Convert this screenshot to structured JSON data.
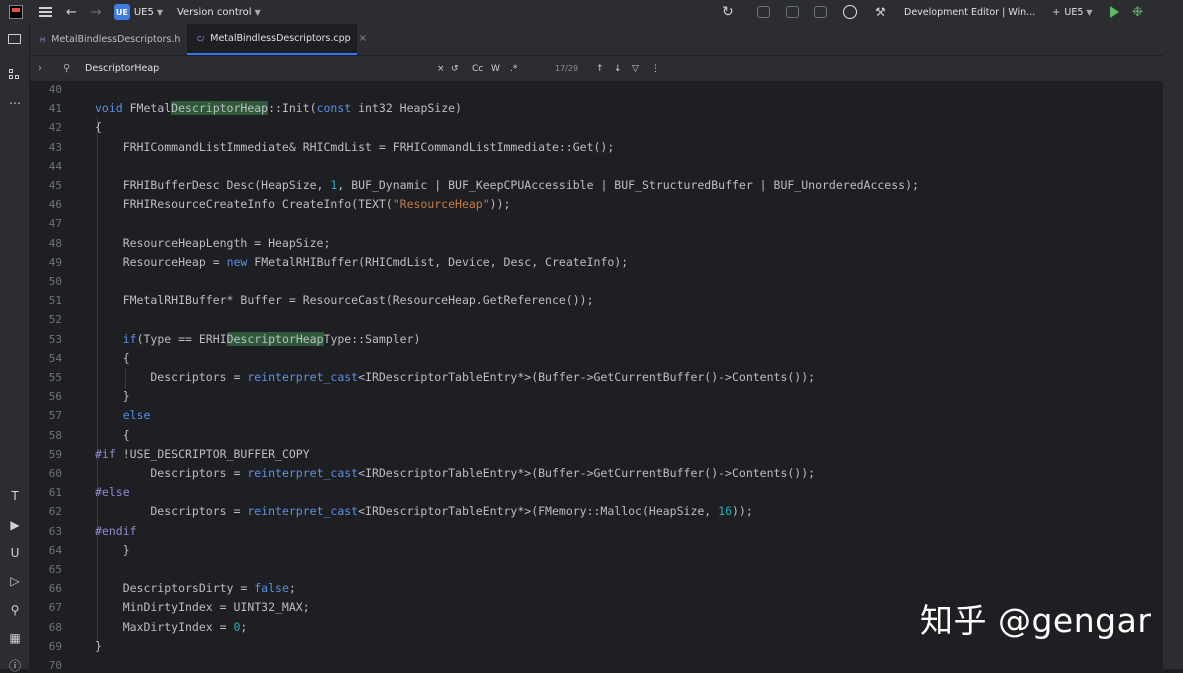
{
  "titlebar": {
    "project_badge": "UE",
    "project_name": "UE5",
    "version_control": "Version control",
    "run_config": "Development Editor | Win...",
    "target": "UE5"
  },
  "tabs": [
    {
      "type": "H",
      "label": "MetalBindlessDescriptors.h",
      "active": false
    },
    {
      "type": "C/",
      "label": "MetalBindlessDescriptors.cpp",
      "active": true
    }
  ],
  "find": {
    "query": "DescriptorHeap",
    "options": [
      "Cc",
      "W",
      ".*"
    ],
    "count": "17/29"
  },
  "colors": {
    "keyword": "#5c8fe3",
    "string": "#c77c47",
    "number": "#2aacb8",
    "preprocessor": "#908bd6",
    "match_highlight": "#2e5a3a"
  },
  "code_lines": [
    {
      "num": "40",
      "text": ""
    },
    {
      "num": "41",
      "text": "void FMetalDescriptorHeap::Init(const int32 HeapSize)"
    },
    {
      "num": "42",
      "text": "{"
    },
    {
      "num": "43",
      "text": "    FRHICommandListImmediate& RHICmdList = FRHICommandListImmediate::Get();"
    },
    {
      "num": "44",
      "text": ""
    },
    {
      "num": "45",
      "text": "    FRHIBufferDesc Desc(HeapSize, 1, BUF_Dynamic | BUF_KeepCPUAccessible | BUF_StructuredBuffer | BUF_UnorderedAccess);"
    },
    {
      "num": "46",
      "text": "    FRHIResourceCreateInfo CreateInfo(TEXT(\"ResourceHeap\"));"
    },
    {
      "num": "47",
      "text": ""
    },
    {
      "num": "48",
      "text": "    ResourceHeapLength = HeapSize;"
    },
    {
      "num": "49",
      "text": "    ResourceHeap = new FMetalRHIBuffer(RHICmdList, Device, Desc, CreateInfo);"
    },
    {
      "num": "50",
      "text": ""
    },
    {
      "num": "51",
      "text": "    FMetalRHIBuffer* Buffer = ResourceCast(ResourceHeap.GetReference());"
    },
    {
      "num": "52",
      "text": ""
    },
    {
      "num": "53",
      "text": "    if(Type == ERHIDescriptorHeapType::Sampler)"
    },
    {
      "num": "54",
      "text": "    {"
    },
    {
      "num": "55",
      "text": "        Descriptors = reinterpret_cast<IRDescriptorTableEntry*>(Buffer->GetCurrentBuffer()->Contents());"
    },
    {
      "num": "56",
      "text": "    }"
    },
    {
      "num": "57",
      "text": "    else"
    },
    {
      "num": "58",
      "text": "    {"
    },
    {
      "num": "59",
      "text": "#if !USE_DESCRIPTOR_BUFFER_COPY"
    },
    {
      "num": "60",
      "text": "        Descriptors = reinterpret_cast<IRDescriptorTableEntry*>(Buffer->GetCurrentBuffer()->Contents());"
    },
    {
      "num": "61",
      "text": "#else"
    },
    {
      "num": "62",
      "text": "        Descriptors = reinterpret_cast<IRDescriptorTableEntry*>(FMemory::Malloc(HeapSize, 16));"
    },
    {
      "num": "63",
      "text": "#endif"
    },
    {
      "num": "64",
      "text": "    }"
    },
    {
      "num": "65",
      "text": ""
    },
    {
      "num": "66",
      "text": "    DescriptorsDirty = false;"
    },
    {
      "num": "67",
      "text": "    MinDirtyIndex = UINT32_MAX;"
    },
    {
      "num": "68",
      "text": "    MaxDirtyIndex = 0;"
    },
    {
      "num": "69",
      "text": "}"
    },
    {
      "num": "70",
      "text": ""
    }
  ],
  "watermark": "知乎 @gengar"
}
